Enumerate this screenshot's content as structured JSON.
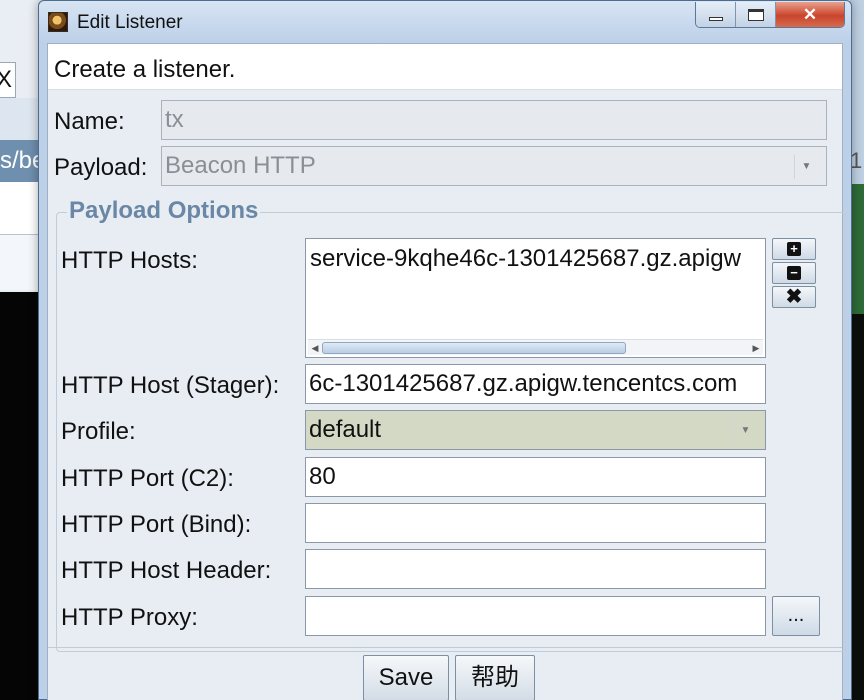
{
  "background": {
    "tab_label": "X",
    "path_fragment": "s/be",
    "right_fragment": "1"
  },
  "window": {
    "title": "Edit Listener",
    "icons": {
      "app": "beacon-app-icon",
      "minimize": "minimize-icon",
      "maximize": "maximize-icon",
      "close": "close-icon"
    },
    "close_glyph": "✕"
  },
  "header": {
    "text": "Create a listener."
  },
  "form": {
    "name_label": "Name:",
    "name_value": "tx",
    "payload_label": "Payload:",
    "payload_value": "Beacon HTTP"
  },
  "payload_options": {
    "title": "Payload Options",
    "http_hosts_label": "HTTP Hosts:",
    "http_hosts": [
      "service-9kqhe46c-1301425687.gz.apigw"
    ],
    "host_buttons": {
      "add": "+",
      "remove": "−",
      "clear": "✖"
    },
    "http_host_stager_label": "HTTP Host (Stager):",
    "http_host_stager_value": "6c-1301425687.gz.apigw.tencentcs.com",
    "profile_label": "Profile:",
    "profile_value": "default",
    "http_port_c2_label": "HTTP Port (C2):",
    "http_port_c2_value": "80",
    "http_port_bind_label": "HTTP Port (Bind):",
    "http_port_bind_value": "",
    "http_host_header_label": "HTTP Host Header:",
    "http_host_header_value": "",
    "http_proxy_label": "HTTP Proxy:",
    "http_proxy_value": "",
    "proxy_button_label": "..."
  },
  "buttons": {
    "save": "Save",
    "help": "帮助"
  },
  "colors": {
    "group_title": "#6a87a6",
    "profile_bg": "#d4d9c6",
    "close_button": "#c9452b"
  }
}
